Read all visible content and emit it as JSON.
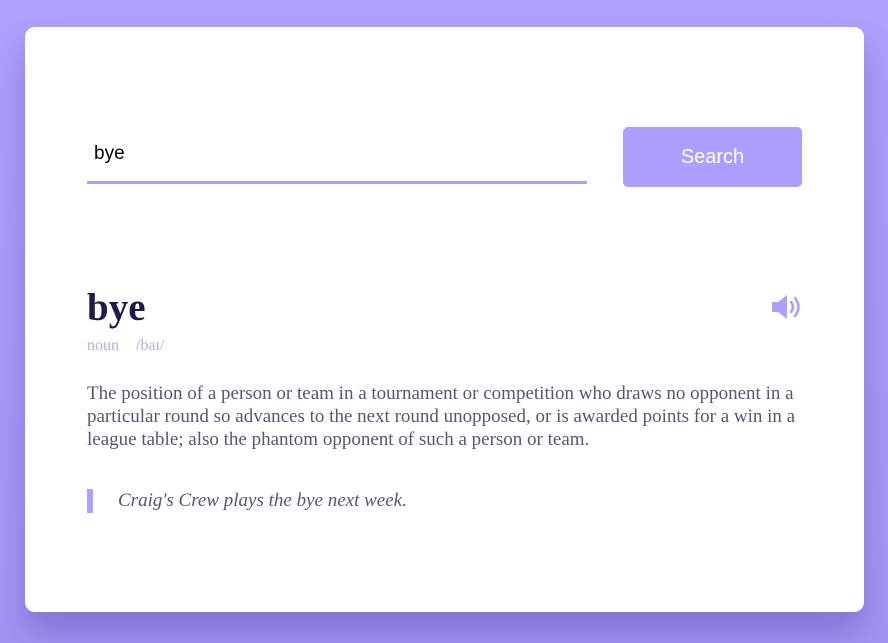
{
  "search": {
    "value": "bye",
    "button_label": "Search"
  },
  "entry": {
    "word": "bye",
    "part_of_speech": "noun",
    "phonetic": "/baɪ/",
    "definition": "The position of a person or team in a tournament or competition who draws no opponent in a particular round so advances to the next round unopposed, or is awarded points for a win in a league table; also the phantom opponent of such a person or team.",
    "example": "Craig's Crew plays the bye next week.",
    "audio_icon": "speaker-icon"
  },
  "colors": {
    "accent": "#ae9ffe",
    "title": "#1d1a4d",
    "body_text": "#545877",
    "muted": "#b4aee0",
    "background": "#a89af8"
  }
}
